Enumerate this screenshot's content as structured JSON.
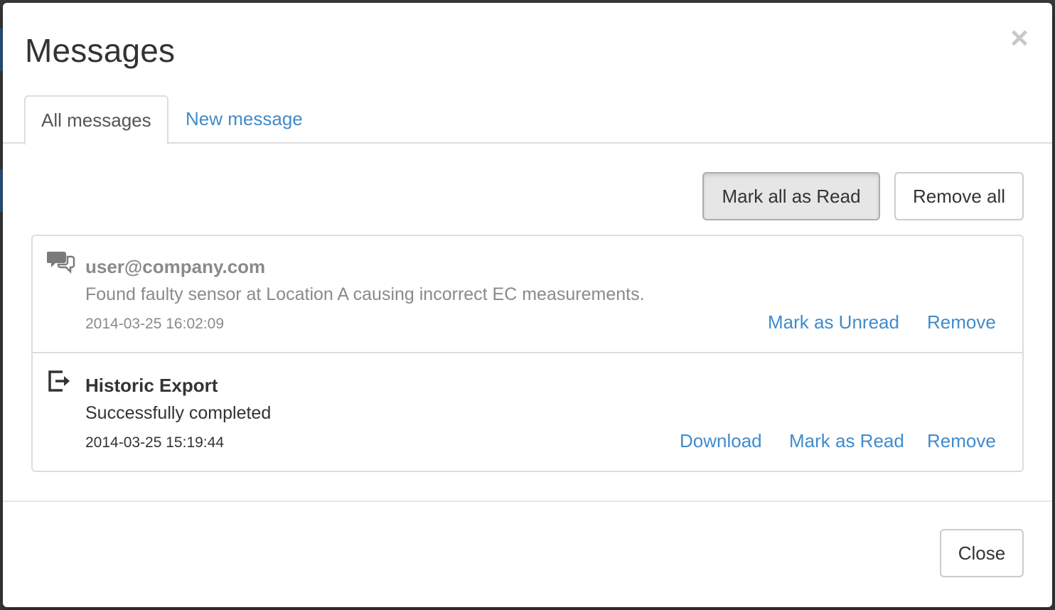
{
  "modal": {
    "title": "Messages",
    "close_symbol": "×"
  },
  "tabs": [
    {
      "label": "All messages",
      "active": true
    },
    {
      "label": "New message",
      "active": false
    }
  ],
  "toolbar": {
    "mark_all_label": "Mark all as Read",
    "remove_all_label": "Remove all"
  },
  "messages": [
    {
      "icon": "chat-bubbles-icon",
      "title": "user@company.com",
      "body": "Found faulty sensor at Location A causing incorrect EC measurements.",
      "timestamp": "2014-03-25 16:02:09",
      "actions": [
        "Mark as Unread",
        "Remove"
      ]
    },
    {
      "icon": "export-icon",
      "title": "Historic Export",
      "body": "Successfully completed",
      "timestamp": "2014-03-25 15:19:44",
      "actions": [
        "Download",
        "Mark as Read",
        "Remove"
      ]
    }
  ],
  "footer": {
    "close_label": "Close"
  },
  "colors": {
    "link": "#428bca",
    "muted": "#8a8a8a",
    "border": "#dddddd"
  }
}
